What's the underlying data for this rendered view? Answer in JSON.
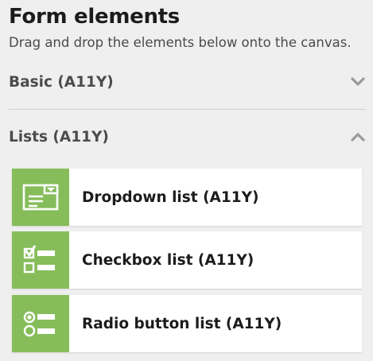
{
  "panel": {
    "title": "Form elements",
    "subtitle": "Drag and drop the elements below onto the canvas."
  },
  "sections": [
    {
      "label": "Basic (A11Y)",
      "state": "collapsed",
      "icon": "chevron-down-icon"
    },
    {
      "label": "Lists (A11Y)",
      "state": "expanded",
      "icon": "chevron-up-icon"
    }
  ],
  "list_items": [
    {
      "label": "Dropdown list (A11Y)",
      "icon": "dropdown-list-icon"
    },
    {
      "label": "Checkbox list (A11Y)",
      "icon": "checkbox-list-icon"
    },
    {
      "label": "Radio button list (A11Y)",
      "icon": "radio-button-list-icon"
    }
  ],
  "colors": {
    "background": "#efefef",
    "tile": "#86bd5a",
    "card": "#ffffff",
    "chevron": "#9a9a9a"
  }
}
